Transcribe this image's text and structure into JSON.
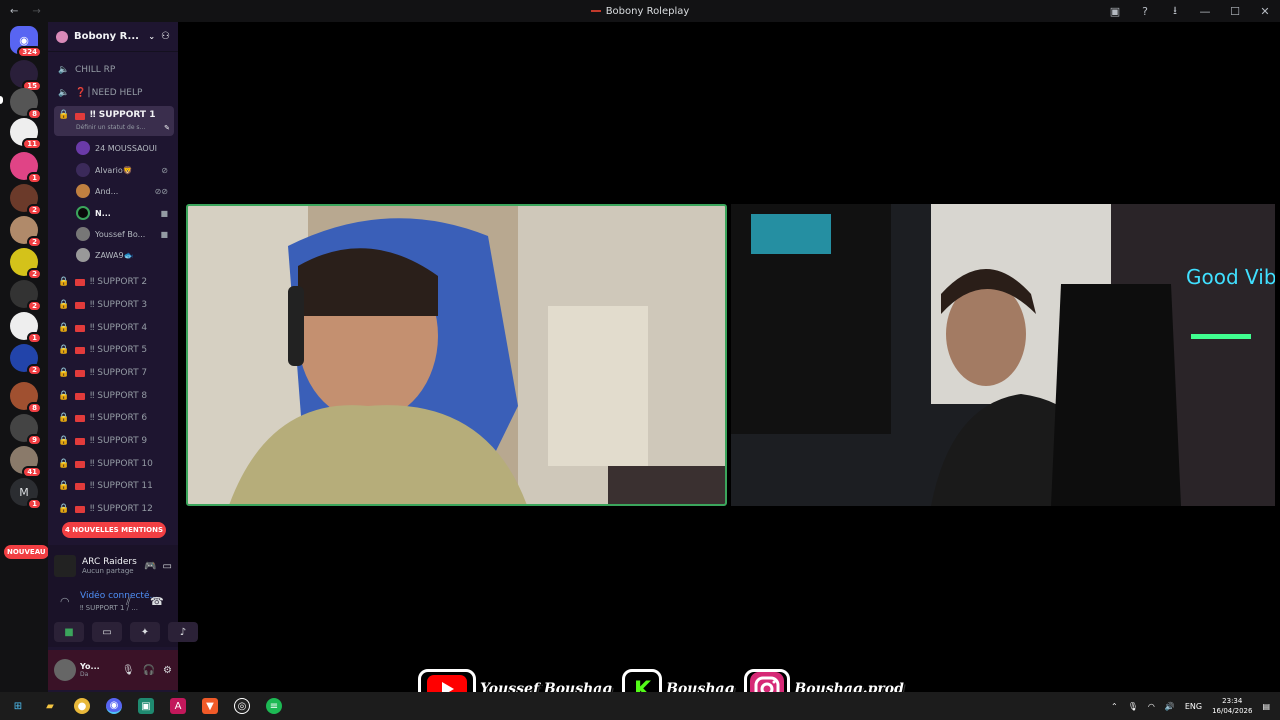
{
  "window": {
    "title": "Bobony Roleplay"
  },
  "servers": {
    "home_badge": "324",
    "badges": [
      "15",
      "8",
      "11",
      "1",
      "2",
      "2",
      "2",
      "2",
      "1",
      "2",
      "8",
      "9",
      "41",
      "1"
    ],
    "letter_server": "M",
    "nouveau_label": "NOUVEAU"
  },
  "guild": {
    "name": "Bobony R..."
  },
  "channels": {
    "chill_rp": "CHILL RP",
    "need_help": "❓│NEED HELP",
    "support1": "‼ SUPPORT 1",
    "support1_sub": "Définir un statut de s...",
    "others": [
      "‼ SUPPORT 2",
      "‼ SUPPORT 3",
      "‼ SUPPORT 4",
      "‼ SUPPORT 5",
      "‼ SUPPORT 7",
      "‼ SUPPORT 8",
      "‼ SUPPORT 6",
      "‼ SUPPORT 9",
      "‼ SUPPORT 10",
      "‼ SUPPORT 11",
      "‼ SUPPORT 12"
    ]
  },
  "voice_users": [
    "24 MOUSSAOUI",
    "Alvario🦁",
    "And...",
    "N...",
    "Youssef Bo...",
    "ZAWA9🐟"
  ],
  "mentions_label": "4 NOUVELLES MENTIONS",
  "activity": {
    "game": "ARC Raiders",
    "status": "Aucun partage"
  },
  "voice": {
    "title": "Vidéo connecté...",
    "channel": "‼ SUPPORT 1 / ..."
  },
  "panel": {
    "username": "Yo...",
    "status": "Da"
  },
  "overlay": {
    "youtube": "Youssef Boushaq",
    "kick": "Boushaq",
    "instagram": "Boushaq.prod"
  },
  "taskbar": {
    "lang": "ENG",
    "time": "23:34",
    "date": "16/04/2026"
  }
}
